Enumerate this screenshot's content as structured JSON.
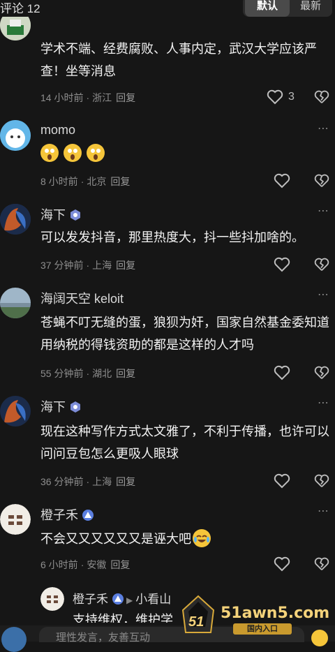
{
  "header": {
    "comment_count": "评论 12",
    "sort_default": "默认",
    "sort_latest": "最新"
  },
  "comments": [
    {
      "name": "",
      "text": "学术不端、经费腐败、人事内定，武汉大学应该严查！坐等消息",
      "time": "14 小时前",
      "location": "浙江",
      "reply": "回复",
      "likes": "3"
    },
    {
      "name": "momo",
      "text": "",
      "emojis": [
        "scared-face",
        "scared-face",
        "scared-face"
      ],
      "time": "8 小时前",
      "location": "北京",
      "reply": "回复",
      "likes": ""
    },
    {
      "name": "海下",
      "text": "可以发发抖音，那里热度大，抖一些抖加啥的。",
      "time": "37 分钟前",
      "location": "上海",
      "reply": "回复",
      "likes": ""
    },
    {
      "name": "海阔天空 keloit",
      "text": "苍蝇不叮无缝的蛋，狼狈为奸，国家自然基金委知道用纳税的得钱资助的都是这样的人才吗",
      "time": "55 分钟前",
      "location": "湖北",
      "reply": "回复",
      "likes": ""
    },
    {
      "name": "海下",
      "text": "现在这种写作方式太文雅了，不利于传播，也许可以问问豆包怎么更吸人眼球",
      "time": "36 分钟前",
      "location": "上海",
      "reply": "回复",
      "likes": ""
    },
    {
      "name": "橙子禾",
      "text": "不会又又又又又又是诬大吧",
      "time": "6 小时前",
      "location": "安徽",
      "reply": "回复",
      "likes": ""
    }
  ],
  "reply_preview": {
    "name": "橙子禾",
    "reply_to": "小看山",
    "text": "支持维权，维护学..."
  },
  "input": {
    "placeholder": "理性发言，友善互动"
  },
  "watermark": {
    "main": "51awn5.com",
    "sub": "国内入口",
    "logo": "51"
  },
  "colors": {
    "background": "#161616",
    "text": "#f2f2f2",
    "meta": "#8e8e8e",
    "badge": "#7d8dd8"
  }
}
